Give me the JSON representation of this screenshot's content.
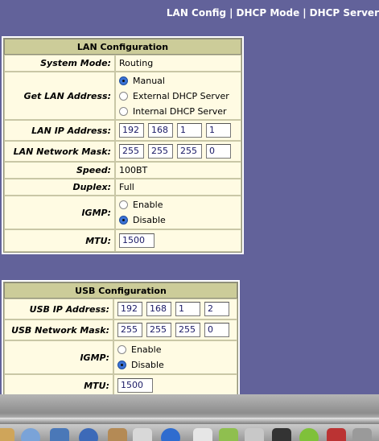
{
  "topnav": {
    "links": [
      "LAN Config",
      "DHCP Mode",
      "DHCP Server"
    ],
    "separator": "|"
  },
  "lan": {
    "title": "LAN Configuration",
    "system_mode_label": "System Mode:",
    "system_mode_value": "Routing",
    "get_lan_label": "Get LAN Address:",
    "get_lan_options": [
      "Manual",
      "External DHCP Server",
      "Internal DHCP Server"
    ],
    "get_lan_selected": "Manual",
    "ip_label": "LAN IP Address:",
    "ip": [
      "192",
      "168",
      "1",
      "1"
    ],
    "mask_label": "LAN Network Mask:",
    "mask": [
      "255",
      "255",
      "255",
      "0"
    ],
    "speed_label": "Speed:",
    "speed_value": "100BT",
    "duplex_label": "Duplex:",
    "duplex_value": "Full",
    "igmp_label": "IGMP:",
    "igmp_options": [
      "Enable",
      "Disable"
    ],
    "igmp_selected": "Disable",
    "mtu_label": "MTU:",
    "mtu_value": "1500"
  },
  "usb": {
    "title": "USB Configuration",
    "ip_label": "USB IP Address:",
    "ip": [
      "192",
      "168",
      "1",
      "2"
    ],
    "mask_label": "USB Network Mask:",
    "mask": [
      "255",
      "255",
      "255",
      "0"
    ],
    "igmp_label": "IGMP:",
    "igmp_options": [
      "Enable",
      "Disable"
    ],
    "igmp_selected": "Disable",
    "mtu_label": "MTU:",
    "mtu_value": "1500"
  },
  "colors": {
    "background": "#62629a",
    "header": "#cccc99",
    "table_bg": "#fffbe3",
    "radio_selected": "#3b73d6"
  },
  "dock": {
    "icons": [
      "finder-icon",
      "safari-icon",
      "mail-icon",
      "calendar-icon",
      "address-book-icon",
      "itunes-icon",
      "preview-icon",
      "textedit-icon",
      "terminal-icon",
      "movie-icon",
      "photo-icon",
      "system-preferences-icon"
    ]
  }
}
